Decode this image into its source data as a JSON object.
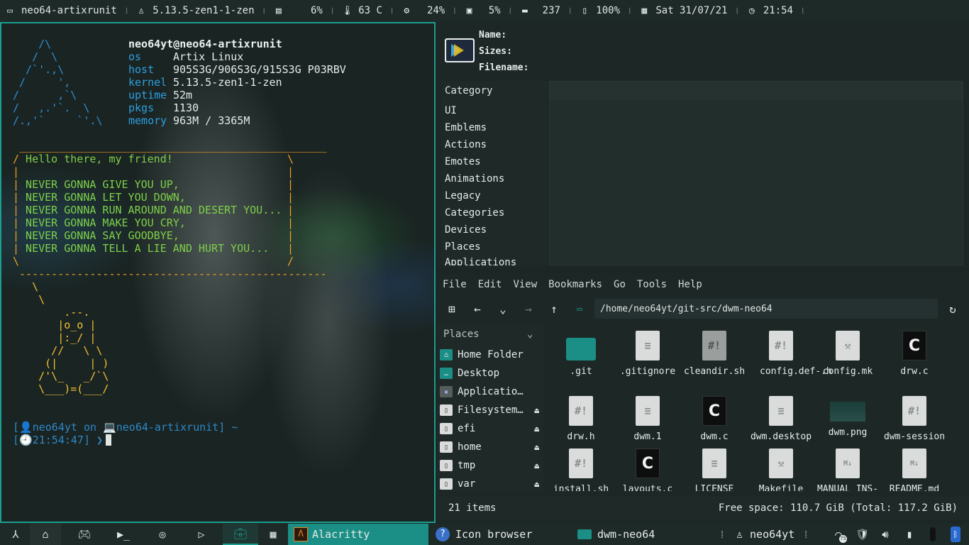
{
  "topbar": {
    "hostname": "neo64-artixrunit",
    "kernel": "5.13.5-zen1-1-zen",
    "cpu": "6%",
    "temp": "63 C",
    "gpu": "24%",
    "disk": "5%",
    "memory": "237",
    "battery": "100%",
    "date": "Sat 31/07/21",
    "time": "21:54",
    "separator": "⁞"
  },
  "terminal": {
    "logo": [
      "    /\\",
      "   /  \\",
      "  /`'.,\\",
      " /     ',",
      "/      ,`\\",
      "/   ,.'`.  \\",
      "/.,'`     `'.\\"
    ],
    "user_host": "neo64yt@neo64-artixrunit",
    "info": [
      {
        "key": "os",
        "value": "Artix Linux"
      },
      {
        "key": "host",
        "value": "905S3G/906S3G/915S3G P03RBV"
      },
      {
        "key": "kernel",
        "value": "5.13.5-zen1-1-zen"
      },
      {
        "key": "uptime",
        "value": "52m"
      },
      {
        "key": "pkgs",
        "value": "1130"
      },
      {
        "key": "memory",
        "value": "963M / 3365M"
      }
    ],
    "cow": {
      "top": " ________________________________________________",
      "lines": [
        {
          "l": "/",
          "t": " Hello there, my friend!",
          "r": "\\"
        },
        {
          "l": "|",
          "t": "",
          "r": "|"
        },
        {
          "l": "|",
          "t": " NEVER GONNA GIVE YOU UP,",
          "r": "|"
        },
        {
          "l": "|",
          "t": " NEVER GONNA LET YOU DOWN,",
          "r": "|"
        },
        {
          "l": "|",
          "t": " NEVER GONNA RUN AROUND AND DESERT YOU...",
          "r": "|"
        },
        {
          "l": "|",
          "t": " NEVER GONNA MAKE YOU CRY,",
          "r": "|"
        },
        {
          "l": "|",
          "t": " NEVER GONNA SAY GOODBYE,",
          "r": "|"
        },
        {
          "l": "|",
          "t": " NEVER GONNA TELL A LIE AND HURT YOU...",
          "r": "|"
        },
        {
          "l": "\\",
          "t": "",
          "r": "/"
        }
      ],
      "bottom": " ------------------------------------------------"
    },
    "tux": [
      "   \\",
      "    \\",
      "        .--.",
      "       |o_o |",
      "       |:_/ |",
      "      //   \\ \\",
      "     (|     | )",
      "    /'\\_   _/`\\",
      "    \\___)=(___/"
    ],
    "prompt_line1": "[👤neo64yt on 💻neo64-artixrunit] ~",
    "prompt_line2": "[🕘21:54:47] ❯"
  },
  "icon_browser": {
    "name_label": "Name:",
    "sizes_label": "Sizes:",
    "filename_label": "Filename:",
    "category_header": "Category",
    "categories": [
      "UI",
      "Emblems",
      "Actions",
      "Emotes",
      "Animations",
      "Legacy",
      "Categories",
      "Devices",
      "Places",
      "Applications"
    ]
  },
  "file_manager": {
    "menu": [
      "File",
      "Edit",
      "View",
      "Bookmarks",
      "Go",
      "Tools",
      "Help"
    ],
    "path": "/home/neo64yt/git-src/dwm-neo64",
    "places_header": "Places",
    "places": [
      {
        "label": "Home Folder",
        "icon": "home-icon",
        "eject": false
      },
      {
        "label": "Desktop",
        "icon": "desktop-icon",
        "eject": false
      },
      {
        "label": "Applicatio…",
        "icon": "applications-icon",
        "eject": false
      },
      {
        "label": "Filesystem…",
        "icon": "drive-icon",
        "eject": true
      },
      {
        "label": "efi",
        "icon": "drive-icon",
        "eject": true
      },
      {
        "label": "home",
        "icon": "drive-icon",
        "eject": true
      },
      {
        "label": "tmp",
        "icon": "drive-icon",
        "eject": true
      },
      {
        "label": "var",
        "icon": "drive-icon",
        "eject": true
      }
    ],
    "files": [
      {
        "name": ".git",
        "kind": "folder"
      },
      {
        "name": ".gitignore",
        "kind": "text"
      },
      {
        "name": "cleandir.sh",
        "kind": "script"
      },
      {
        "name": "config.def-.h",
        "kind": "header"
      },
      {
        "name": "config.mk",
        "kind": "make"
      },
      {
        "name": "drw.c",
        "kind": "c"
      },
      {
        "name": "drw.h",
        "kind": "header"
      },
      {
        "name": "dwm.1",
        "kind": "text"
      },
      {
        "name": "dwm.c",
        "kind": "c"
      },
      {
        "name": "dwm.desktop",
        "kind": "text"
      },
      {
        "name": "dwm.png",
        "kind": "image"
      },
      {
        "name": "dwm-session",
        "kind": "script"
      },
      {
        "name": "install.sh",
        "kind": "script"
      },
      {
        "name": "layouts.c",
        "kind": "c"
      },
      {
        "name": "LICENSE",
        "kind": "text"
      },
      {
        "name": "Makefile",
        "kind": "make"
      },
      {
        "name": "MANUAL_INS-",
        "kind": "md"
      },
      {
        "name": "README.md",
        "kind": "md"
      }
    ],
    "status_items": "21 items",
    "status_space": "Free space: 110.7 GiB (Total: 117.2 GiB)"
  },
  "bottombar": {
    "tasks": [
      {
        "label": "Alacritty",
        "icon": "alacritty-icon"
      },
      {
        "label": "Icon browser",
        "icon": "help-icon"
      },
      {
        "label": "dwm-neo64",
        "icon": "folder-icon"
      }
    ],
    "user": "neo64yt",
    "separator": "⁞",
    "volume_level": "75"
  },
  "colors": {
    "accent": "#1b9e8f",
    "background": "#1c2624"
  }
}
